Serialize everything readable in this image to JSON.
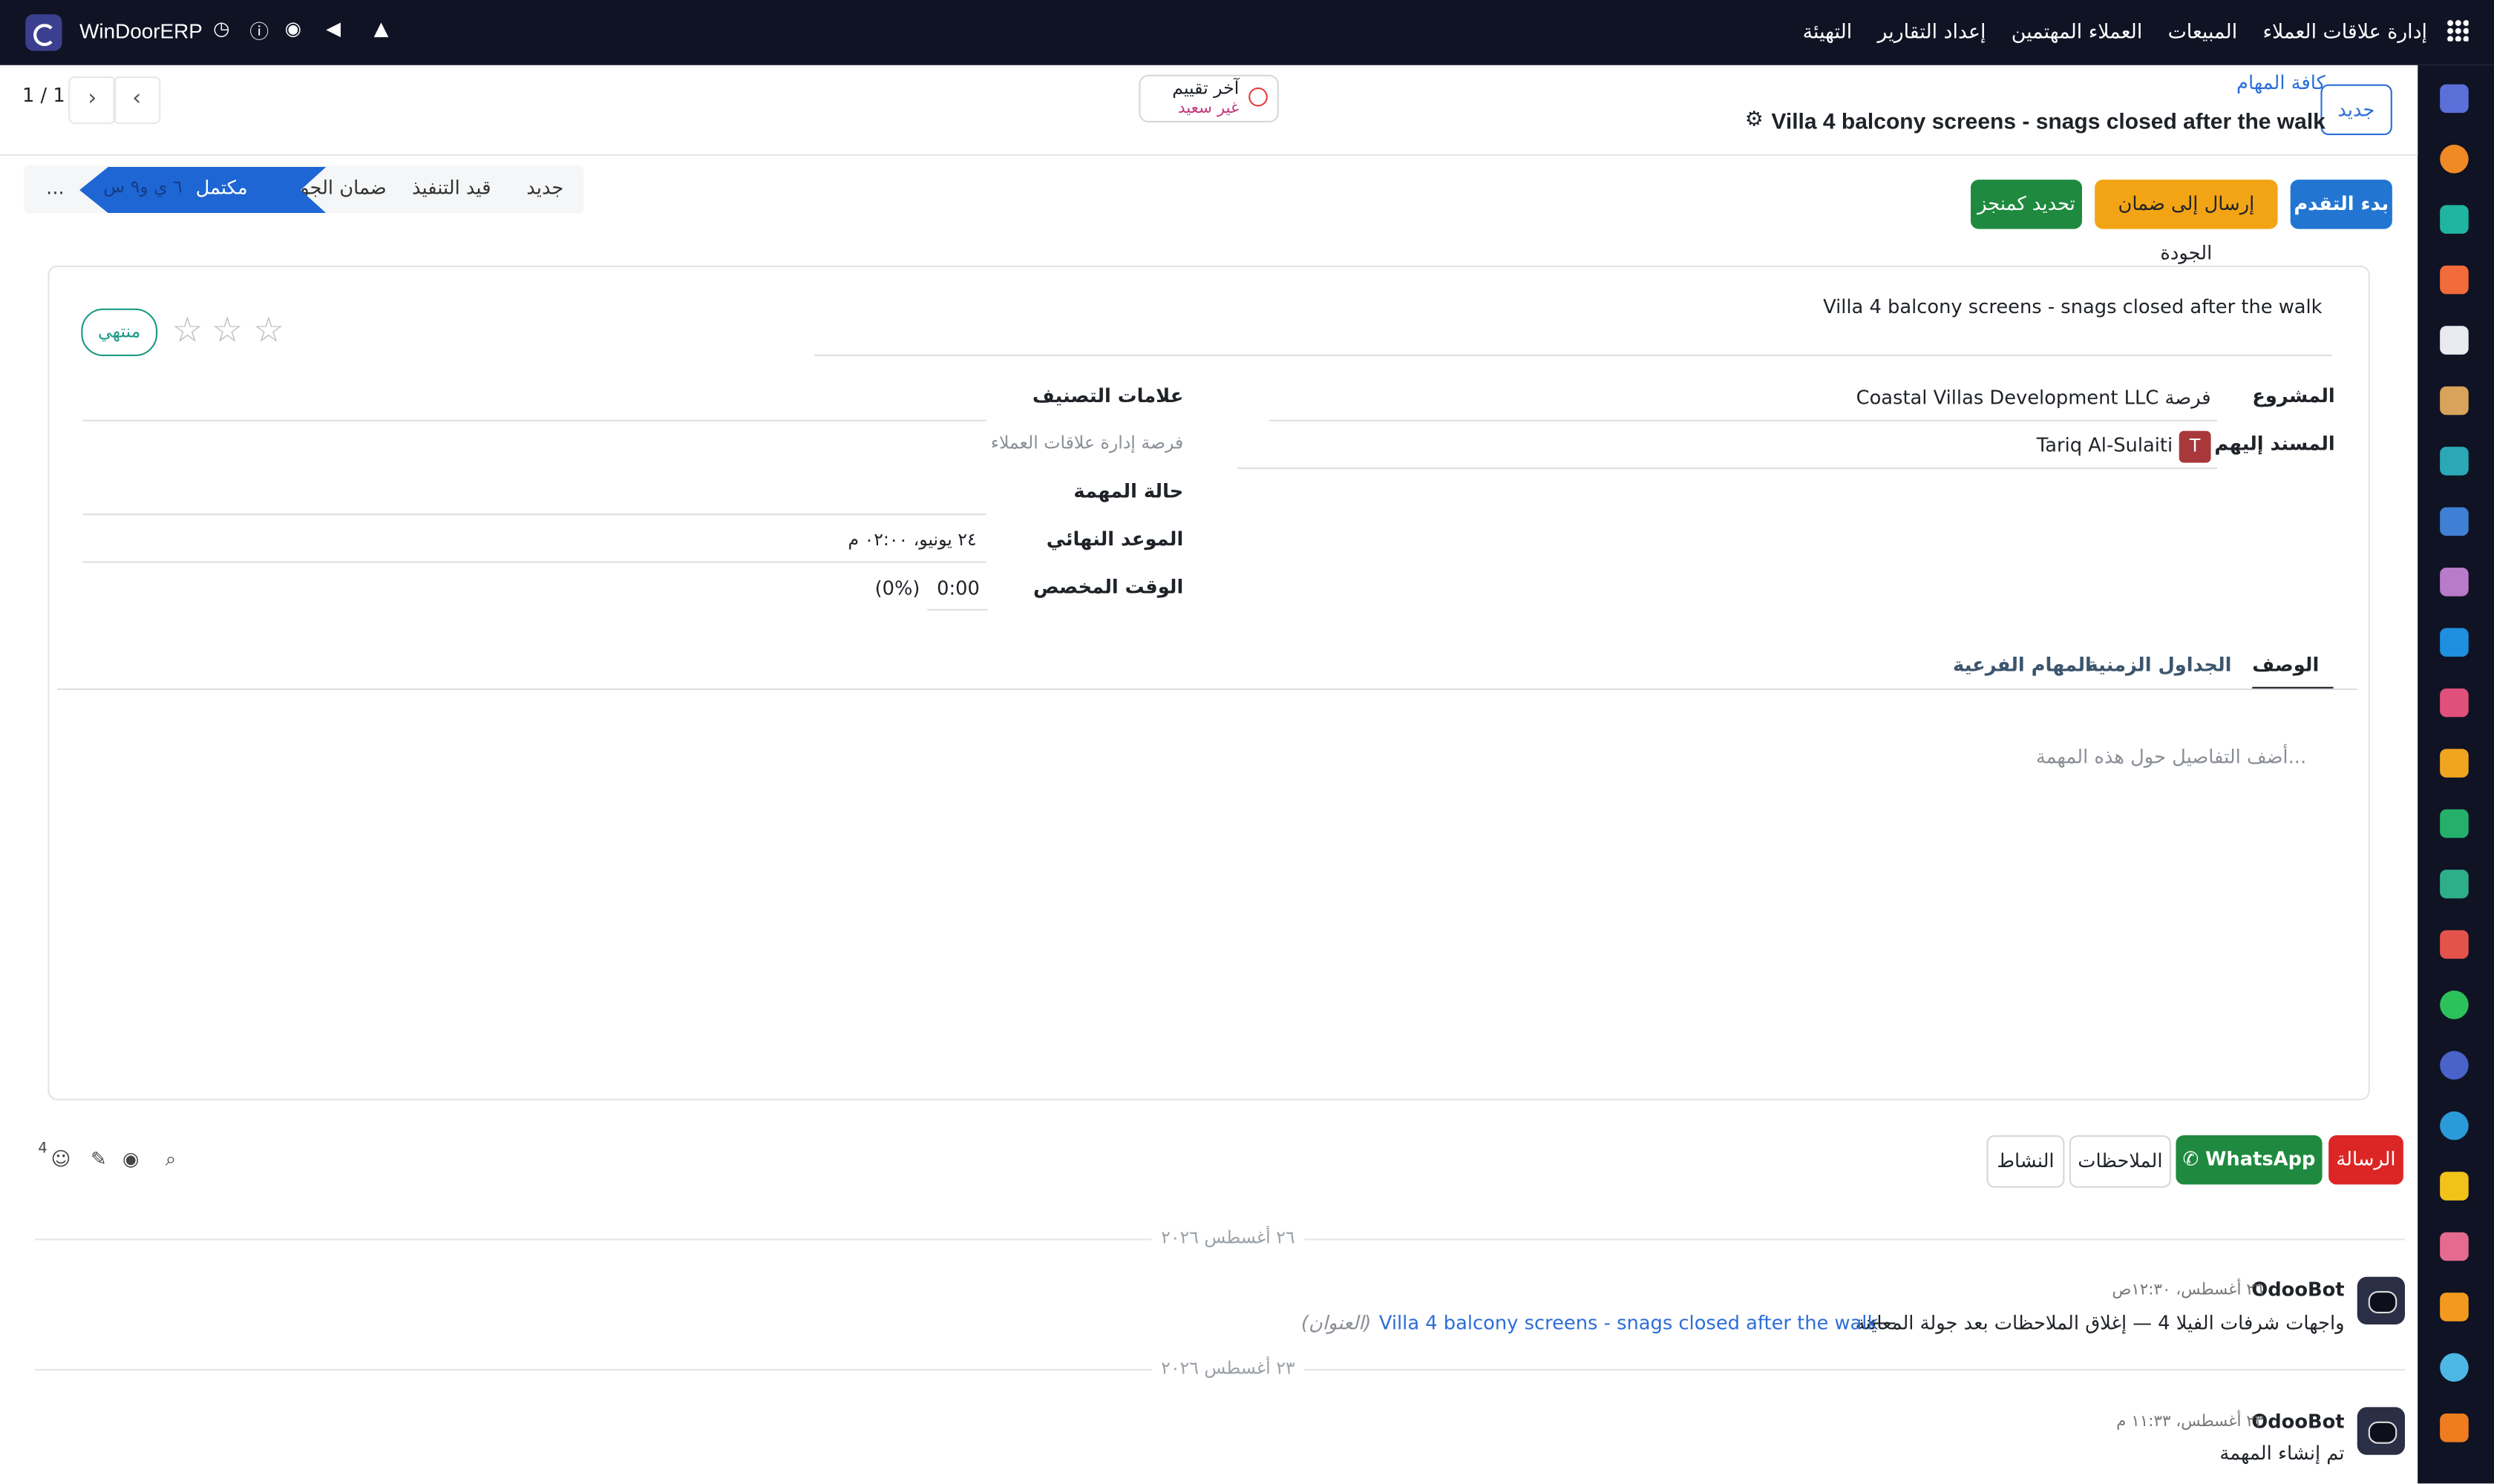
{
  "topbar": {
    "brand": "WinDoorERP",
    "menu": [
      "إدارة علاقات العملاء",
      "المبيعات",
      "العملاء المهتمين",
      "إعداد التقارير",
      "التهيئة"
    ],
    "icons": [
      "clock-icon",
      "help-icon",
      "chat-icon",
      "megaphone-icon",
      "bell-icon",
      "apps-grid-icon"
    ]
  },
  "control": {
    "new_label": "جديد",
    "breadcrumb": "كافة المهام",
    "record_title": "Villa 4 balcony screens - snags closed after the walk",
    "rating_title": "آخر تقييم",
    "rating_value": "غير سعيد",
    "pager": "1 / 1"
  },
  "actions": {
    "start": "بدء التقدم",
    "send_qa": "إرسال إلى ضمان الجودة",
    "set_done": "تحديد كمنجز",
    "more": "..."
  },
  "statusbar": {
    "stages": [
      "جديد",
      "قيد التنفيذ",
      "ضمان الجودة",
      "مكتمل"
    ],
    "active_stage": "مكتمل",
    "active_sub": "٦ ي و٩ س"
  },
  "form": {
    "task_name": "Villa 4 balcony screens - snags closed after the walk",
    "state_badge": "منتهي",
    "stars": 3,
    "project_label": "المشروع",
    "project_value": "Coastal Villas Development LLC فرصة",
    "assignee_label": "المسند إليهم",
    "assignee_value": "Tariq Al-Sulaiti",
    "assignee_initial": "T",
    "tags_label": "علامات التصنيف",
    "crm_link_label": "فرصة إدارة علاقات العملاء",
    "task_state_label": "حالة المهمة",
    "deadline_label": "الموعد النهائي",
    "deadline_value": "٢٤ يونيو، ٠٢:٠٠ م",
    "allocated_label": "الوقت المخصص",
    "allocated_value": "0:00",
    "allocated_pct": "(0%)",
    "tabs": [
      "الوصف",
      "الجداول الزمنية",
      "المهام الفرعية"
    ],
    "description_placeholder": "أضف التفاصيل حول هذه المهمة..."
  },
  "chatter": {
    "message_btn": "الرسالة",
    "whatsapp_btn": "WhatsApp",
    "notes_btn": "الملاحظات",
    "activity_btn": "النشاط",
    "followers_count": "4",
    "date1": "٢٦ أغسطس ٢٠٢٦",
    "date2": "٢٣ أغسطس ٢٠٢٦",
    "msg1_author": "OdooBot",
    "msg1_time": "٢٦ أغسطس، ١٢:٣٠ص",
    "msg1_old": "واجهات شرفات الفيلا 4 — إغلاق الملاحظات بعد جولة المعاينة",
    "msg1_arrow": "⟵",
    "msg1_new": "Villa 4 balcony screens - snags closed after the walk",
    "msg1_field": "(العنوان)",
    "msg2_author": "OdooBot",
    "msg2_time": "٢٣ أغسطس، ١١:٣٣ م",
    "msg2_text": "تم إنشاء المهمة"
  },
  "colors": {
    "navbar": "#0f1324",
    "primary": "#2276d2",
    "warning": "#f3a414",
    "success": "#1f8a3f",
    "danger": "#dc2626",
    "teal": "#1c9a86"
  }
}
